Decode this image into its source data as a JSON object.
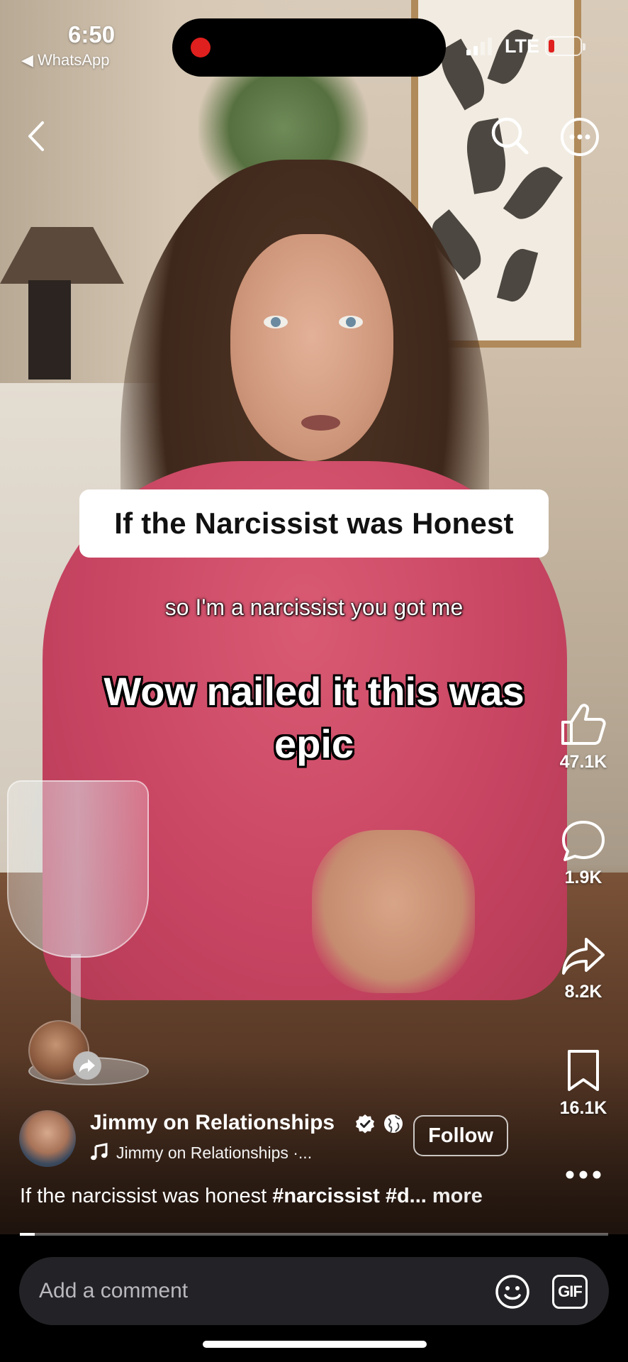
{
  "status_bar": {
    "time": "6:50",
    "back_app": "◀ WhatsApp",
    "network": "LTE"
  },
  "overlay": {
    "title": "If the Narcissist was Honest",
    "caption": "so I'm a narcissist you got me",
    "comment": "Wow nailed it this was epic"
  },
  "actions": {
    "likes": "47.1K",
    "comments": "1.9K",
    "shares": "8.2K",
    "saves": "16.1K"
  },
  "author": {
    "name": "Jimmy on Relationships",
    "follow_label": "Follow",
    "audio": "Jimmy on Relationships ·..."
  },
  "description": {
    "text": "If the narcissist was honest ",
    "tag1": "#narcissist",
    "tag2": " #d...",
    "more": " more"
  },
  "progress": 0.025,
  "comment_bar": {
    "placeholder": "Add a comment",
    "gif_label": "GIF"
  },
  "colors": {
    "record_dot": "#e0201e",
    "shirt": "#c94663",
    "comment_field": "#232327"
  }
}
